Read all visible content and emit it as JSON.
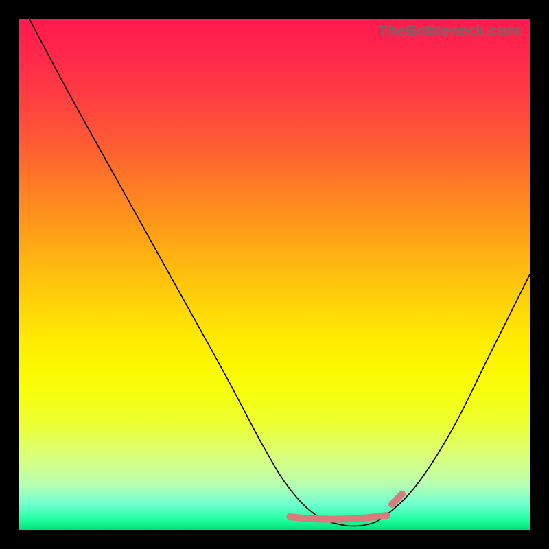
{
  "watermark": "TheBottleneck.com",
  "colors": {
    "frame": "#000000",
    "curve": "#000000",
    "highlight": "#d97b7b",
    "gradient_top": "#ff1a4d",
    "gradient_bottom": "#00e078"
  },
  "chart_data": {
    "type": "line",
    "title": "",
    "xlabel": "",
    "ylabel": "",
    "xlim": [
      0,
      100
    ],
    "ylim": [
      0,
      100
    ],
    "grid": false,
    "legend": false,
    "note": "Axes are unitless — values estimated from pixel positions within the 744×744 plot rectangle. y=0 is bottom, y=100 is top.",
    "series": [
      {
        "name": "curve",
        "x": [
          2,
          10,
          20,
          30,
          40,
          48,
          53,
          58,
          63,
          68,
          72,
          78,
          85,
          92,
          100
        ],
        "y": [
          100,
          85,
          67,
          49,
          31,
          16,
          8,
          3,
          1,
          1,
          3,
          9,
          20,
          34,
          50
        ]
      }
    ],
    "highlight_band": {
      "name": "bottom-flat-region",
      "x": [
        53,
        72
      ],
      "y_approx": 2,
      "extra_segment": {
        "x": [
          73,
          75
        ],
        "y_approx": 5
      }
    }
  }
}
